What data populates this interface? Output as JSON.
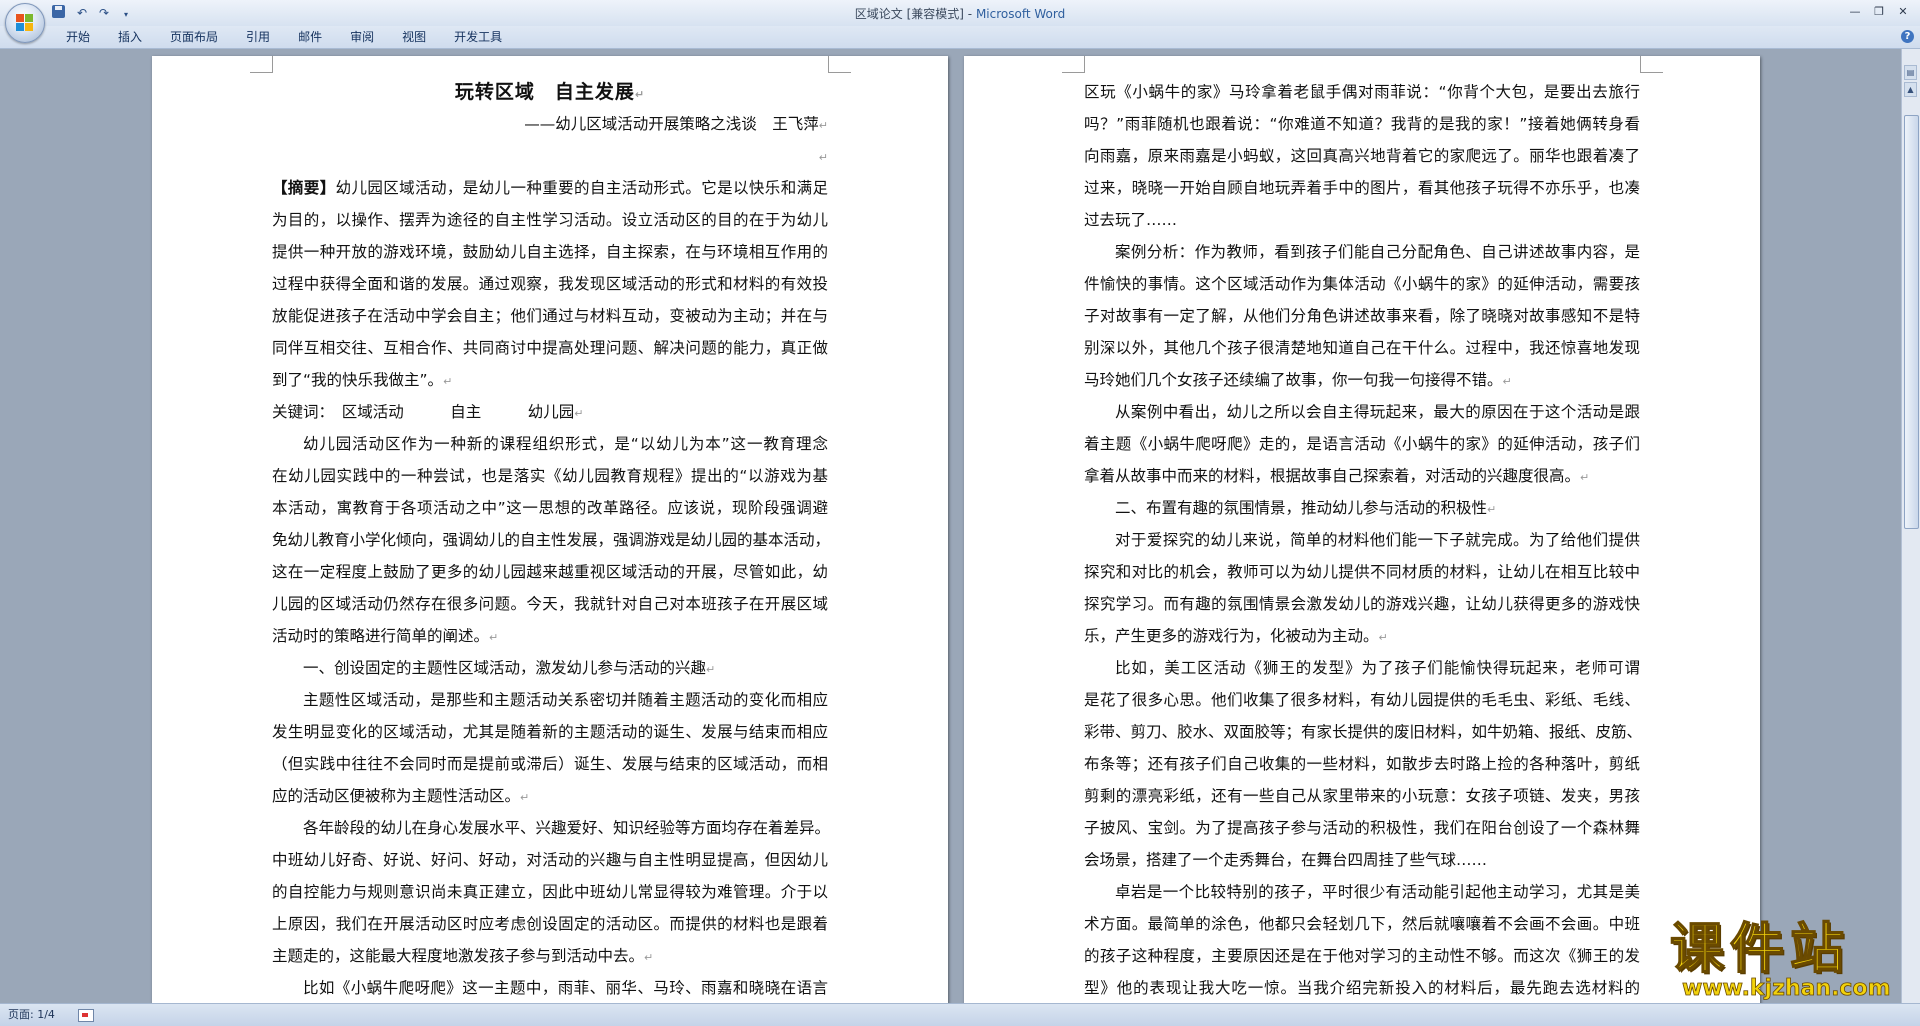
{
  "window": {
    "doc_name": "区域论文",
    "mode": "[兼容模式]",
    "separator": " - ",
    "app_name": "Microsoft Word"
  },
  "ribbon": {
    "tabs": [
      "开始",
      "插入",
      "页面布局",
      "引用",
      "邮件",
      "审阅",
      "视图",
      "开发工具"
    ]
  },
  "icons": {
    "office_button": "office-logo-icon",
    "save": "save-icon",
    "undo": "undo-icon",
    "redo": "redo-icon",
    "customize": "dropdown-icon",
    "help": "help-icon",
    "pilcrow": "paragraph-mark-icon"
  },
  "help_glyph": "?",
  "pilcrow": "↵",
  "page1": {
    "title": "玩转区域　自主发展",
    "subtitle": "——幼儿区域活动开展策略之浅谈　王飞萍",
    "lines": [
      "",
      "【摘要】幼儿园区域活动，是幼儿一种重要的自主活动形式。它是以快乐和满足",
      "为目的，以操作、摆弄为途径的自主性学习活动。设立活动区的目的在于为幼儿",
      "提供一种开放的游戏环境，鼓励幼儿自主选择，自主探索，在与环境相互作用的",
      "过程中获得全面和谐的发展。通过观察，我发现区域活动的形式和材料的有效投",
      "放能促进孩子在活动中学会自主；他们通过与材料互动，变被动为主动；并在与",
      "同伴互相交往、互相合作、共同商讨中提高处理问题、解决问题的能力，真正做",
      "到了“我的快乐我做主”。",
      "关键词：　区域活动　　　自主　　　幼儿园",
      "幼儿园活动区作为一种新的课程组织形式，是“以幼儿为本”这一教育理念",
      "在幼儿园实践中的一种尝试，也是落实《幼儿园教育规程》提出的“以游戏为基",
      "本活动，寓教育于各项活动之中”这一思想的改革路径。应该说，现阶段强调避",
      "免幼儿教育小学化倾向，强调幼儿的自主性发展，强调游戏是幼儿园的基本活动，",
      "这在一定程度上鼓励了更多的幼儿园越来越重视区域活动的开展，尽管如此，幼",
      "儿园的区域活动仍然存在很多问题。今天，我就针对自己对本班孩子在开展区域",
      "活动时的策略进行简单的阐述。",
      "一、创设固定的主题性区域活动，激发幼儿参与活动的兴趣",
      "主题性区域活动，是那些和主题活动关系密切并随着主题活动的变化而相应",
      "发生明显变化的区域活动，尤其是随着新的主题活动的诞生、发展与结束而相应",
      "（但实践中往往不会同时而是提前或滞后）诞生、发展与结束的区域活动，而相",
      "应的活动区便被称为主题性活动区。",
      "各年龄段的幼儿在身心发展水平、兴趣爱好、知识经验等方面均存在着差异。",
      "中班幼儿好奇、好说、好问、好动，对活动的兴趣与自主性明显提高，但因幼儿",
      "的自控能力与规则意识尚未真正建立，因此中班幼儿常显得较为难管理。介于以",
      "上原因，我们在开展活动区时应考虑创设固定的活动区。而提供的材料也是跟着",
      "主题走的，这能最大程度地激发孩子参与到活动中去。",
      "比如《小蜗牛爬呀爬》这一主题中，雨菲、丽华、马玲、雨嘉和晓晓在语言"
    ]
  },
  "page2": {
    "lines": [
      "区玩《小蜗牛的家》马玲拿着老鼠手偶对雨菲说：“你背个大包，是要出去旅行",
      "吗？”雨菲随机也跟着说：“你难道不知道？我背的是我的家！”接着她俩转身看",
      "向雨嘉，原来雨嘉是小蚂蚁，这回真高兴地背着它的家爬远了。丽华也跟着凑了",
      "过来，晓晓一开始自顾自地玩弄着手中的图片，看其他孩子玩得不亦乐乎，也凑",
      "过去玩了……",
      "案例分析：作为教师，看到孩子们能自己分配角色、自己讲述故事内容，是",
      "件愉快的事情。这个区域活动作为集体活动《小蜗牛的家》的延伸活动，需要孩",
      "子对故事有一定了解，从他们分角色讲述故事来看，除了晓晓对故事感知不是特",
      "别深以外，其他几个孩子很清楚地知道自己在干什么。过程中，我还惊喜地发现",
      "马玲她们几个女孩子还续编了故事，你一句我一句接得不错。",
      "从案例中看出，幼儿之所以会自主得玩起来，最大的原因在于这个活动是跟",
      "着主题《小蜗牛爬呀爬》走的，是语言活动《小蜗牛的家》的延伸活动，孩子们",
      "拿着从故事中而来的材料，根据故事自己探索着，对活动的兴趣度很高。",
      "二、布置有趣的氛围情景，推动幼儿参与活动的积极性",
      "对于爱探究的幼儿来说，简单的材料他们能一下子就完成。为了给他们提供",
      "探究和对比的机会，教师可以为幼儿提供不同材质的材料，让幼儿在相互比较中",
      "探究学习。而有趣的氛围情景会激发幼儿的游戏兴趣，让幼儿获得更多的游戏快",
      "乐，产生更多的游戏行为，化被动为主动。",
      "比如，美工区活动《狮王的发型》为了孩子们能愉快得玩起来，老师可谓",
      "是花了很多心思。他们收集了很多材料，有幼儿园提供的毛毛虫、彩纸、毛线、",
      "彩带、剪刀、胶水、双面胶等；有家长提供的废旧材料，如牛奶箱、报纸、皮筋、",
      "布条等；还有孩子们自己收集的一些材料，如散步去时路上捡的各种落叶，剪纸",
      "剪剩的漂亮彩纸，还有一些自己从家里带来的小玩意：女孩子项链、发夹，男孩",
      "子披风、宝剑。为了提高孩子参与活动的积极性，我们在阳台创设了一个森林舞",
      "会场景，搭建了一个走秀舞台，在舞台四周挂了些气球……",
      "卓岩是一个比较特别的孩子，平时很少有活动能引起他主动学习，尤其是美",
      "术方面。最简单的涂色，他都只会轻划几下，然后就嚷嚷着不会画不会画。中班",
      "的孩子这种程度，主要原因还是在于他对学习的主动性不够。而这次《狮王的发",
      "型》他的表现让我大吃一惊。当我介绍完新投入的材料后，最先跑去选材料的"
    ]
  },
  "status": {
    "page_info": "页面: 1/4"
  },
  "watermark": {
    "title": "课件站",
    "url": "www.kjzhan.com"
  }
}
